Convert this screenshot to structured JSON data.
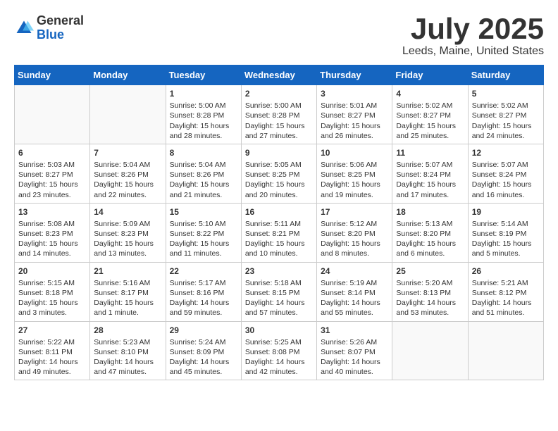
{
  "header": {
    "logo_general": "General",
    "logo_blue": "Blue",
    "month_title": "July 2025",
    "location": "Leeds, Maine, United States"
  },
  "weekdays": [
    "Sunday",
    "Monday",
    "Tuesday",
    "Wednesday",
    "Thursday",
    "Friday",
    "Saturday"
  ],
  "weeks": [
    [
      {
        "day": "",
        "sunrise": "",
        "sunset": "",
        "daylight": ""
      },
      {
        "day": "",
        "sunrise": "",
        "sunset": "",
        "daylight": ""
      },
      {
        "day": "1",
        "sunrise": "Sunrise: 5:00 AM",
        "sunset": "Sunset: 8:28 PM",
        "daylight": "Daylight: 15 hours and 28 minutes."
      },
      {
        "day": "2",
        "sunrise": "Sunrise: 5:00 AM",
        "sunset": "Sunset: 8:28 PM",
        "daylight": "Daylight: 15 hours and 27 minutes."
      },
      {
        "day": "3",
        "sunrise": "Sunrise: 5:01 AM",
        "sunset": "Sunset: 8:27 PM",
        "daylight": "Daylight: 15 hours and 26 minutes."
      },
      {
        "day": "4",
        "sunrise": "Sunrise: 5:02 AM",
        "sunset": "Sunset: 8:27 PM",
        "daylight": "Daylight: 15 hours and 25 minutes."
      },
      {
        "day": "5",
        "sunrise": "Sunrise: 5:02 AM",
        "sunset": "Sunset: 8:27 PM",
        "daylight": "Daylight: 15 hours and 24 minutes."
      }
    ],
    [
      {
        "day": "6",
        "sunrise": "Sunrise: 5:03 AM",
        "sunset": "Sunset: 8:27 PM",
        "daylight": "Daylight: 15 hours and 23 minutes."
      },
      {
        "day": "7",
        "sunrise": "Sunrise: 5:04 AM",
        "sunset": "Sunset: 8:26 PM",
        "daylight": "Daylight: 15 hours and 22 minutes."
      },
      {
        "day": "8",
        "sunrise": "Sunrise: 5:04 AM",
        "sunset": "Sunset: 8:26 PM",
        "daylight": "Daylight: 15 hours and 21 minutes."
      },
      {
        "day": "9",
        "sunrise": "Sunrise: 5:05 AM",
        "sunset": "Sunset: 8:25 PM",
        "daylight": "Daylight: 15 hours and 20 minutes."
      },
      {
        "day": "10",
        "sunrise": "Sunrise: 5:06 AM",
        "sunset": "Sunset: 8:25 PM",
        "daylight": "Daylight: 15 hours and 19 minutes."
      },
      {
        "day": "11",
        "sunrise": "Sunrise: 5:07 AM",
        "sunset": "Sunset: 8:24 PM",
        "daylight": "Daylight: 15 hours and 17 minutes."
      },
      {
        "day": "12",
        "sunrise": "Sunrise: 5:07 AM",
        "sunset": "Sunset: 8:24 PM",
        "daylight": "Daylight: 15 hours and 16 minutes."
      }
    ],
    [
      {
        "day": "13",
        "sunrise": "Sunrise: 5:08 AM",
        "sunset": "Sunset: 8:23 PM",
        "daylight": "Daylight: 15 hours and 14 minutes."
      },
      {
        "day": "14",
        "sunrise": "Sunrise: 5:09 AM",
        "sunset": "Sunset: 8:23 PM",
        "daylight": "Daylight: 15 hours and 13 minutes."
      },
      {
        "day": "15",
        "sunrise": "Sunrise: 5:10 AM",
        "sunset": "Sunset: 8:22 PM",
        "daylight": "Daylight: 15 hours and 11 minutes."
      },
      {
        "day": "16",
        "sunrise": "Sunrise: 5:11 AM",
        "sunset": "Sunset: 8:21 PM",
        "daylight": "Daylight: 15 hours and 10 minutes."
      },
      {
        "day": "17",
        "sunrise": "Sunrise: 5:12 AM",
        "sunset": "Sunset: 8:20 PM",
        "daylight": "Daylight: 15 hours and 8 minutes."
      },
      {
        "day": "18",
        "sunrise": "Sunrise: 5:13 AM",
        "sunset": "Sunset: 8:20 PM",
        "daylight": "Daylight: 15 hours and 6 minutes."
      },
      {
        "day": "19",
        "sunrise": "Sunrise: 5:14 AM",
        "sunset": "Sunset: 8:19 PM",
        "daylight": "Daylight: 15 hours and 5 minutes."
      }
    ],
    [
      {
        "day": "20",
        "sunrise": "Sunrise: 5:15 AM",
        "sunset": "Sunset: 8:18 PM",
        "daylight": "Daylight: 15 hours and 3 minutes."
      },
      {
        "day": "21",
        "sunrise": "Sunrise: 5:16 AM",
        "sunset": "Sunset: 8:17 PM",
        "daylight": "Daylight: 15 hours and 1 minute."
      },
      {
        "day": "22",
        "sunrise": "Sunrise: 5:17 AM",
        "sunset": "Sunset: 8:16 PM",
        "daylight": "Daylight: 14 hours and 59 minutes."
      },
      {
        "day": "23",
        "sunrise": "Sunrise: 5:18 AM",
        "sunset": "Sunset: 8:15 PM",
        "daylight": "Daylight: 14 hours and 57 minutes."
      },
      {
        "day": "24",
        "sunrise": "Sunrise: 5:19 AM",
        "sunset": "Sunset: 8:14 PM",
        "daylight": "Daylight: 14 hours and 55 minutes."
      },
      {
        "day": "25",
        "sunrise": "Sunrise: 5:20 AM",
        "sunset": "Sunset: 8:13 PM",
        "daylight": "Daylight: 14 hours and 53 minutes."
      },
      {
        "day": "26",
        "sunrise": "Sunrise: 5:21 AM",
        "sunset": "Sunset: 8:12 PM",
        "daylight": "Daylight: 14 hours and 51 minutes."
      }
    ],
    [
      {
        "day": "27",
        "sunrise": "Sunrise: 5:22 AM",
        "sunset": "Sunset: 8:11 PM",
        "daylight": "Daylight: 14 hours and 49 minutes."
      },
      {
        "day": "28",
        "sunrise": "Sunrise: 5:23 AM",
        "sunset": "Sunset: 8:10 PM",
        "daylight": "Daylight: 14 hours and 47 minutes."
      },
      {
        "day": "29",
        "sunrise": "Sunrise: 5:24 AM",
        "sunset": "Sunset: 8:09 PM",
        "daylight": "Daylight: 14 hours and 45 minutes."
      },
      {
        "day": "30",
        "sunrise": "Sunrise: 5:25 AM",
        "sunset": "Sunset: 8:08 PM",
        "daylight": "Daylight: 14 hours and 42 minutes."
      },
      {
        "day": "31",
        "sunrise": "Sunrise: 5:26 AM",
        "sunset": "Sunset: 8:07 PM",
        "daylight": "Daylight: 14 hours and 40 minutes."
      },
      {
        "day": "",
        "sunrise": "",
        "sunset": "",
        "daylight": ""
      },
      {
        "day": "",
        "sunrise": "",
        "sunset": "",
        "daylight": ""
      }
    ]
  ]
}
